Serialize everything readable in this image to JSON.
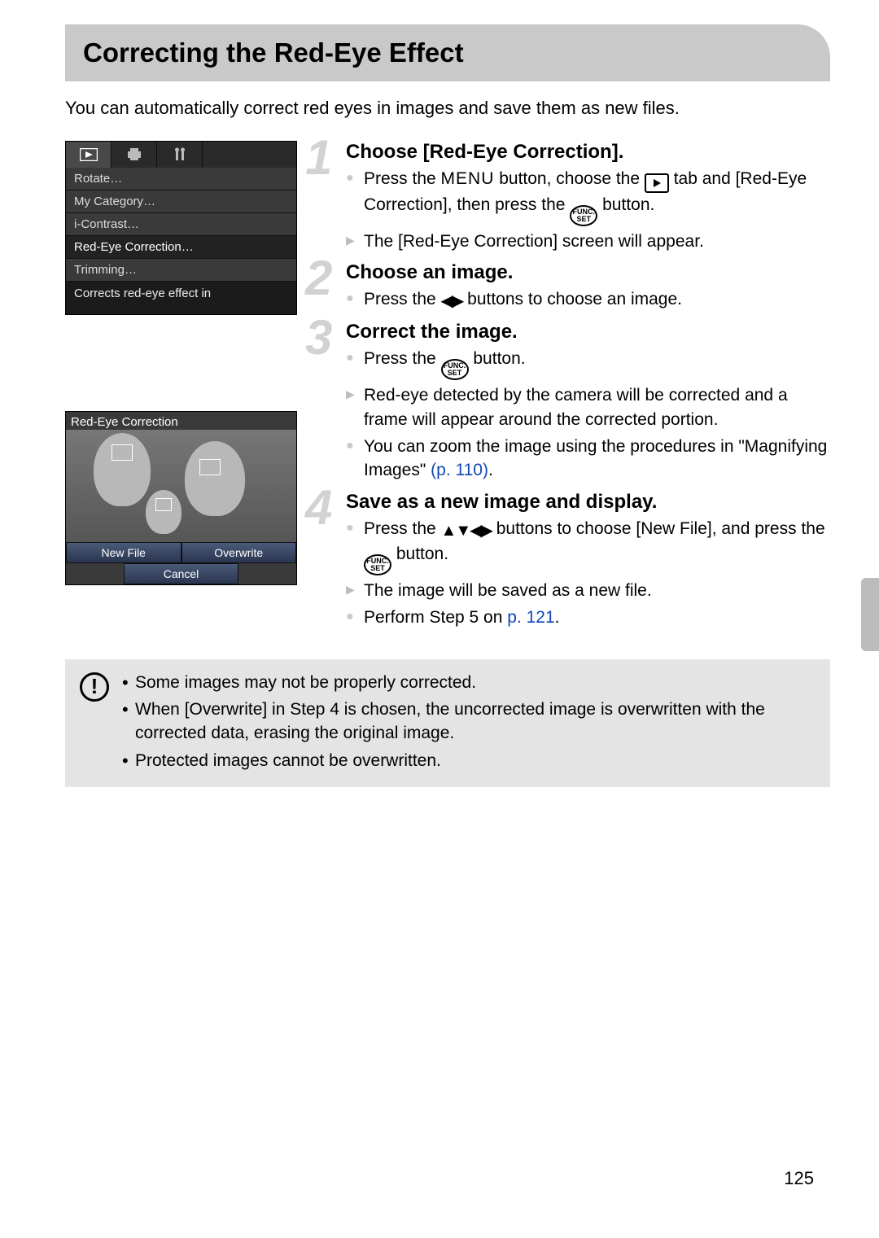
{
  "page": {
    "title": "Correcting the Red-Eye Effect",
    "intro": "You can automatically correct red eyes in images and save them as new files.",
    "number": "125"
  },
  "screenshots": {
    "menu": {
      "items": [
        "Rotate…",
        "My Category…",
        "i-Contrast…",
        "Red-Eye Correction…",
        "Trimming…"
      ],
      "selected_index": 3,
      "hint": "Corrects red-eye effect in"
    },
    "redeye": {
      "title": "Red-Eye Correction",
      "btn_new": "New File",
      "btn_over": "Overwrite",
      "btn_cancel": "Cancel"
    }
  },
  "steps": [
    {
      "num": "1",
      "title": "Choose [Red-Eye Correction].",
      "lines": [
        {
          "type": "dot",
          "pre": "Press the ",
          "mid1": "MENU",
          "txt1": " button, choose the ",
          "icon": "play",
          "txt2": " tab and [Red-Eye Correction], then press the ",
          "icon2": "func",
          "txt3": " button."
        },
        {
          "type": "tri",
          "text": "The [Red-Eye Correction] screen will appear."
        }
      ]
    },
    {
      "num": "2",
      "title": "Choose an image.",
      "lines": [
        {
          "type": "dot",
          "pre": "Press the ",
          "arrows": "lr",
          "txt1": " buttons to choose an image."
        }
      ]
    },
    {
      "num": "3",
      "title": "Correct the image.",
      "lines": [
        {
          "type": "dot",
          "pre": "Press the ",
          "icon": "func",
          "txt1": " button."
        },
        {
          "type": "tri",
          "text": "Red-eye detected by the camera will be corrected and a frame will appear around the corrected portion."
        },
        {
          "type": "dot",
          "pre": "You can zoom the image using the procedures in \"Magnifying Images\" ",
          "ref": "(p. 110)",
          "txt1": "."
        }
      ]
    },
    {
      "num": "4",
      "title": "Save as a new image and display.",
      "lines": [
        {
          "type": "dot",
          "pre": "Press the ",
          "arrows": "udlr",
          "txt1": " buttons to choose [New File], and press the ",
          "icon": "func",
          "txt2": " button."
        },
        {
          "type": "tri",
          "text": "The image will be saved as a new file."
        },
        {
          "type": "dot",
          "pre": "Perform Step 5 on ",
          "ref": "p. 121",
          "txt1": "."
        }
      ]
    }
  ],
  "caution": [
    "Some images may not be properly corrected.",
    "When [Overwrite] in Step 4 is chosen, the uncorrected image is overwritten with the corrected data, erasing the original image.",
    "Protected images cannot be overwritten."
  ],
  "icons": {
    "func_top": "FUNC.",
    "func_bot": "SET"
  }
}
